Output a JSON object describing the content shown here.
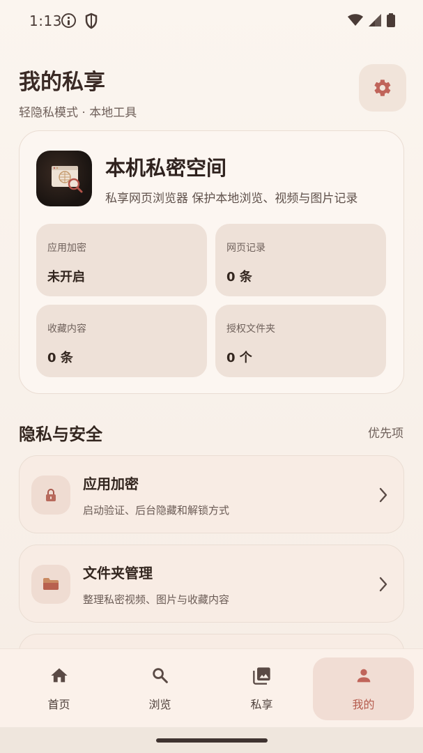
{
  "status_bar": {
    "time": "1:13"
  },
  "header": {
    "title": "我的私享",
    "subtitle": "轻隐私模式 · 本地工具"
  },
  "hero": {
    "title": "本机私密空间",
    "description": "私享网页浏览器 保护本地浏览、视频与图片记录",
    "stats": [
      {
        "label": "应用加密",
        "value": "未开启"
      },
      {
        "label": "网页记录",
        "value": "0 条"
      },
      {
        "label": "收藏内容",
        "value": "0 条"
      },
      {
        "label": "授权文件夹",
        "value": "0 个"
      }
    ]
  },
  "section": {
    "title": "隐私与安全",
    "action": "优先项"
  },
  "settings_list": [
    {
      "title": "应用加密",
      "description": "启动验证、后台隐藏和解锁方式",
      "icon": "lock-icon"
    },
    {
      "title": "文件夹管理",
      "description": "整理私密视频、图片与收藏内容",
      "icon": "folder-icon"
    }
  ],
  "bottom_nav": [
    {
      "label": "首页",
      "icon": "home-icon",
      "active": false
    },
    {
      "label": "浏览",
      "icon": "search-icon",
      "active": false
    },
    {
      "label": "私享",
      "icon": "gallery-icon",
      "active": false
    },
    {
      "label": "我的",
      "icon": "person-icon",
      "active": true
    }
  ],
  "colors": {
    "accent": "#c0645a",
    "background": "#f8efe8",
    "card": "#fcf6f1",
    "tile": "#eee1d8"
  }
}
